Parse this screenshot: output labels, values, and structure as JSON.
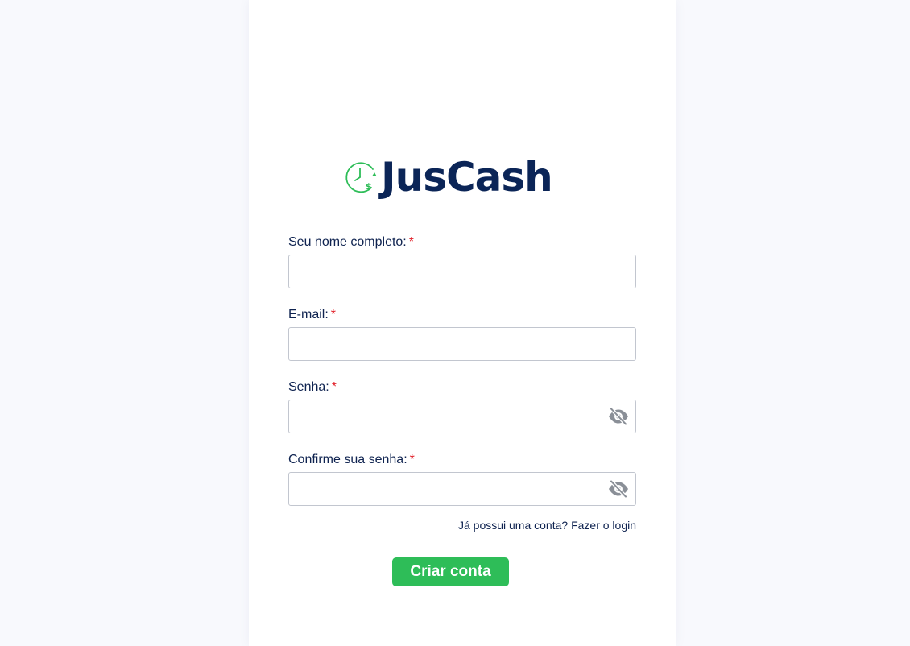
{
  "brand": {
    "name": "JusCash",
    "color": "#0b2557",
    "accent": "#2ebd58",
    "icon": "clock-dollar-icon",
    "icon_glyph": "$"
  },
  "form": {
    "fields": [
      {
        "label": "Seu nome completo:",
        "required_mark": "*",
        "value": "",
        "type": "text"
      },
      {
        "label": "E-mail:",
        "required_mark": "*",
        "value": "",
        "type": "email"
      },
      {
        "label": "Senha:",
        "required_mark": "*",
        "value": "",
        "type": "password",
        "toggle_icon": "eye-off-icon"
      },
      {
        "label": "Confirme sua senha:",
        "required_mark": "*",
        "value": "",
        "type": "password",
        "toggle_icon": "eye-off-icon"
      }
    ],
    "login_link": "Já possui uma conta? Fazer o login",
    "submit_label": "Criar conta"
  }
}
